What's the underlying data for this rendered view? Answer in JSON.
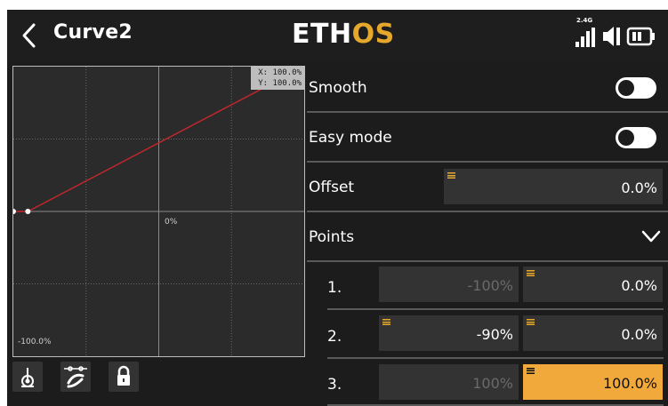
{
  "header": {
    "title": "Curve2",
    "logo_main": "ETH",
    "logo_accent": "OS",
    "band_label": "2.4G"
  },
  "graph": {
    "coord_x": "X: 100.0%",
    "coord_y": "Y: 100.0%",
    "center_label": "0%",
    "bottom_label": "-100.0%"
  },
  "settings": {
    "smooth_label": "Smooth",
    "smooth_on": false,
    "easy_mode_label": "Easy mode",
    "easy_mode_on": false,
    "offset_label": "Offset",
    "offset_value": "0.0%",
    "points_label": "Points"
  },
  "points": [
    {
      "index": "1.",
      "x": "-100%",
      "y": "0.0%"
    },
    {
      "index": "2.",
      "x": "-90%",
      "y": "0.0%"
    },
    {
      "index": "3.",
      "x": "100%",
      "y": "100.0%"
    }
  ],
  "chart_data": {
    "type": "line",
    "x": [
      -100,
      -90,
      100
    ],
    "y": [
      0,
      0,
      100
    ],
    "xlim": [
      -100,
      100
    ],
    "ylim": [
      -100,
      100
    ],
    "grid": true
  },
  "colors": {
    "accent": "#e6a82c",
    "curve": "#c1272d",
    "active_field": "#f2a93b"
  },
  "icons": {
    "back": "chevron-left-icon",
    "signal": "signal-bars-icon",
    "speaker": "speaker-icon",
    "battery": "battery-icon",
    "stick": "stick-icon",
    "link": "link-points-icon",
    "lock": "lock-icon",
    "points_toggle": "chevron-down-icon"
  }
}
